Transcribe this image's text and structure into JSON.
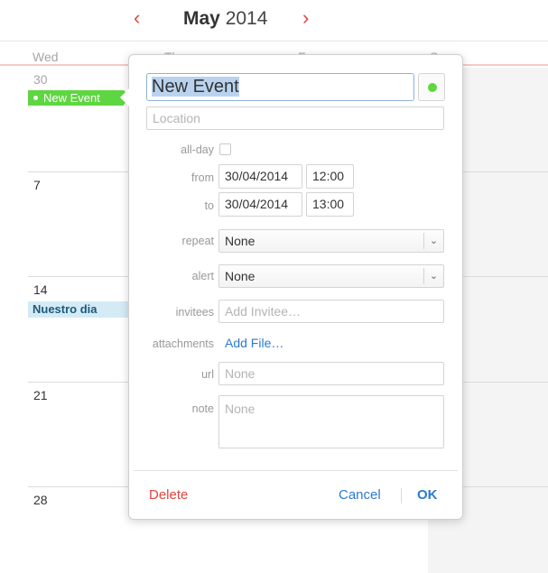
{
  "header": {
    "prev_icon": "chevron-left-icon",
    "next_icon": "chevron-right-icon",
    "month": "May",
    "year": "2014"
  },
  "day_headers": [
    "Wed",
    "Th",
    "Fr",
    "Sa"
  ],
  "weeks": [
    {
      "date": "30",
      "muted": true
    },
    {
      "date": "7"
    },
    {
      "date": "14"
    },
    {
      "date": "21"
    },
    {
      "date": "28"
    }
  ],
  "events": {
    "new_event": "New Event",
    "nuestro_dia": "Nuestro dia"
  },
  "colors": {
    "accent_red": "#e0443e",
    "link_blue": "#2b7bd0",
    "event_green": "#5ed641",
    "event_blue_bg": "#d4ebf6"
  },
  "editor": {
    "title_value": "New Event",
    "location_placeholder": "Location",
    "labels": {
      "all_day": "all-day",
      "from": "from",
      "to": "to",
      "repeat": "repeat",
      "alert": "alert",
      "invitees": "invitees",
      "attachments": "attachments",
      "url": "url",
      "note": "note"
    },
    "from_date": "30/04/2014",
    "from_time": "12:00",
    "to_date": "30/04/2014",
    "to_time": "13:00",
    "repeat_value": "None",
    "alert_value": "None",
    "invitees_placeholder": "Add Invitee…",
    "add_file_label": "Add File…",
    "url_placeholder": "None",
    "note_placeholder": "None",
    "delete_label": "Delete",
    "cancel_label": "Cancel",
    "ok_label": "OK"
  }
}
